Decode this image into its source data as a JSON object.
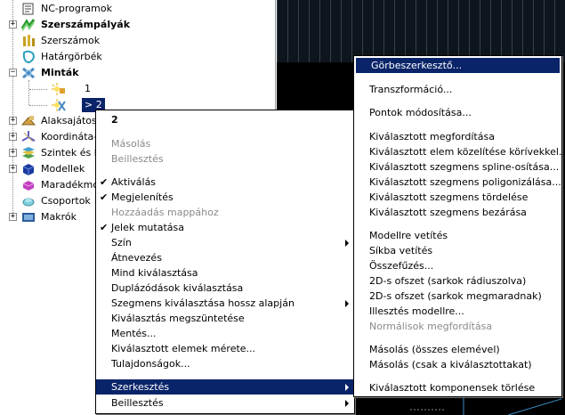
{
  "tree": {
    "items": [
      {
        "label": "NC-programok",
        "icon": "nc-program-icon",
        "bold": false
      },
      {
        "label": "Szerszámpályák",
        "icon": "toolpath-icon",
        "bold": true
      },
      {
        "label": "Szerszámok",
        "icon": "tool-icon",
        "bold": false
      },
      {
        "label": "Határgörbék",
        "icon": "boundary-icon",
        "bold": false
      },
      {
        "label": "Minták",
        "icon": "pattern-icon",
        "bold": true
      },
      {
        "label": "1",
        "icon": "pattern-item-icon",
        "bold": false
      },
      {
        "label": "> 2",
        "icon": "pattern-item-icon",
        "bold": false
      },
      {
        "label": "Alaksajátossá",
        "icon": "feature-icon",
        "bold": false
      },
      {
        "label": "Koordináta-re",
        "icon": "workplane-icon",
        "bold": false
      },
      {
        "label": "Szintek és ha",
        "icon": "levels-icon",
        "bold": false
      },
      {
        "label": "Modellek",
        "icon": "model-icon",
        "bold": false
      },
      {
        "label": "Maradékmod",
        "icon": "stock-model-icon",
        "bold": false
      },
      {
        "label": "Csoportok",
        "icon": "group-icon",
        "bold": false
      },
      {
        "label": "Makrók",
        "icon": "macro-icon",
        "bold": false
      }
    ]
  },
  "context_menu": {
    "title": "2",
    "items": [
      {
        "label": "Másolás",
        "disabled": true
      },
      {
        "label": "Beillesztés",
        "disabled": true
      },
      {
        "label": "Aktiválás",
        "checked": true
      },
      {
        "label": "Megjelenítés",
        "checked": true
      },
      {
        "label": "Hozzáadás mappához",
        "disabled": true
      },
      {
        "label": "Jelek mutatása",
        "checked": true
      },
      {
        "label": "Szín",
        "submenu": true
      },
      {
        "label": "Átnevezés"
      },
      {
        "label": "Mind kiválasztása"
      },
      {
        "label": "Duplázódások kiválasztása"
      },
      {
        "label": "Szegmens kiválasztása hossz alapján",
        "submenu": true
      },
      {
        "label": "Kiválasztás megszüntetése"
      },
      {
        "label": "Mentés..."
      },
      {
        "label": "Kiválasztott elemek mérete..."
      },
      {
        "label": "Tulajdonságok..."
      },
      {
        "label": "Szerkesztés",
        "submenu": true,
        "highlighted": true
      },
      {
        "label": "Beillesztés",
        "submenu": true
      }
    ]
  },
  "submenu": {
    "items": [
      {
        "label": "Görbeszerkesztő...",
        "highlighted": true
      },
      {
        "label": "Transzformáció..."
      },
      {
        "label": "Pontok módosítása..."
      },
      {
        "label": "Kiválasztott megfordítása"
      },
      {
        "label": "Kiválasztott elem közelítése körívekkel..."
      },
      {
        "label": "Kiválasztott szegmens spline-osítása..."
      },
      {
        "label": "Kiválasztott szegmens poligonizálása..."
      },
      {
        "label": "Kiválasztott szegmens tördelése"
      },
      {
        "label": "Kiválasztott szegmens bezárása"
      },
      {
        "label": "Modellre vetítés"
      },
      {
        "label": "Síkba vetítés"
      },
      {
        "label": "Összefűzés..."
      },
      {
        "label": "2D-s ofszet (sarkok rádiuszolva)"
      },
      {
        "label": "2D-s ofszet (sarkok megmaradnak)"
      },
      {
        "label": "Illesztés modellre..."
      },
      {
        "label": "Normálisok megfordítása",
        "disabled": true
      },
      {
        "label": "Másolás (összes elemével)"
      },
      {
        "label": "Másolás (csak a kiválasztottakat)"
      },
      {
        "label": "Kiválasztott komponensek törlése"
      }
    ]
  },
  "colors": {
    "selection": "#0a246a",
    "disabled_text": "#8a8a8a",
    "viewport": "#000000"
  }
}
